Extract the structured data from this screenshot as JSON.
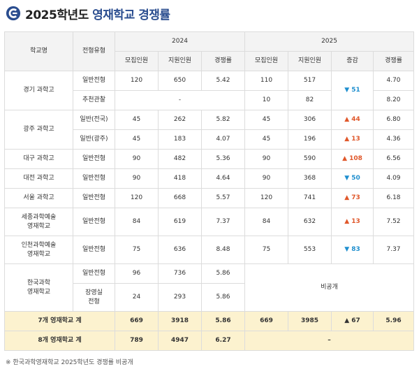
{
  "header": {
    "year_text": "2025학년도",
    "rest_text": "영재학교 경쟁률"
  },
  "table": {
    "col_school": "학교명",
    "col_type": "전형유형",
    "year_2024": "2024",
    "year_2025": "2025",
    "sub_recruit": "모집인원",
    "sub_apply": "지원인원",
    "sub_rate": "경쟁률",
    "sub_change": "증감"
  },
  "rows": {
    "gyeonggi": {
      "school": "경기 과학고",
      "r1": {
        "type": "일반전형",
        "a": "120",
        "b": "650",
        "c": "5.42",
        "d": "110",
        "e": "517",
        "g": "4.70"
      },
      "r2": {
        "type": "추천관찰",
        "merged": "-",
        "d": "10",
        "e": "82",
        "g": "8.20"
      },
      "change": "▼ 51"
    },
    "gwangju": {
      "school": "광주 과학고",
      "r1": {
        "type": "일반(전국)",
        "a": "45",
        "b": "262",
        "c": "5.82",
        "d": "45",
        "e": "306",
        "f": "▲ 44",
        "g": "6.80"
      },
      "r2": {
        "type": "일반(광주)",
        "a": "45",
        "b": "183",
        "c": "4.07",
        "d": "45",
        "e": "196",
        "f": "▲ 13",
        "g": "4.36"
      }
    },
    "daegu": {
      "school": "대구 과학고",
      "type": "일반전형",
      "a": "90",
      "b": "482",
      "c": "5.36",
      "d": "90",
      "e": "590",
      "f": "▲ 108",
      "g": "6.56"
    },
    "daejeon": {
      "school": "대전 과학고",
      "type": "일반전형",
      "a": "90",
      "b": "418",
      "c": "4.64",
      "d": "90",
      "e": "368",
      "f": "▼ 50",
      "g": "4.09"
    },
    "seoul": {
      "school": "서울 과학고",
      "type": "일반전형",
      "a": "120",
      "b": "668",
      "c": "5.57",
      "d": "120",
      "e": "741",
      "f": "▲ 73",
      "g": "6.18"
    },
    "sejong": {
      "school1": "세종과학예술",
      "school2": "영재학교",
      "type": "일반전형",
      "a": "84",
      "b": "619",
      "c": "7.37",
      "d": "84",
      "e": "632",
      "f": "▲ 13",
      "g": "7.52"
    },
    "incheon": {
      "school1": "인천과학예술",
      "school2": "영재학교",
      "type": "일반전형",
      "a": "75",
      "b": "636",
      "c": "8.48",
      "d": "75",
      "e": "553",
      "f": "▼ 83",
      "g": "7.37"
    },
    "korea": {
      "school1": "한국과학",
      "school2": "영재학교",
      "r1": {
        "type": "일반전형",
        "a": "96",
        "b": "736",
        "c": "5.86"
      },
      "r2": {
        "type1": "장영실",
        "type2": "전형",
        "a": "24",
        "b": "293",
        "c": "5.86"
      },
      "undisclosed": "비공개"
    }
  },
  "summary": {
    "total7": {
      "label": "7개 영재학교 계",
      "a": "669",
      "b": "3918",
      "c": "5.86",
      "d": "669",
      "e": "3985",
      "f": "▲ 67",
      "g": "5.96"
    },
    "total8": {
      "label": "8개 영재학교 계",
      "a": "789",
      "b": "4947",
      "c": "6.27",
      "merged": "–"
    }
  },
  "note": "※ 한국과학영재학교 2025학년도 경쟁률 비공개",
  "colors": {
    "up": "#e0572a",
    "down": "#1f8fcf",
    "accent": "#2a4d8f",
    "summary_bg": "#fcf2cf"
  }
}
